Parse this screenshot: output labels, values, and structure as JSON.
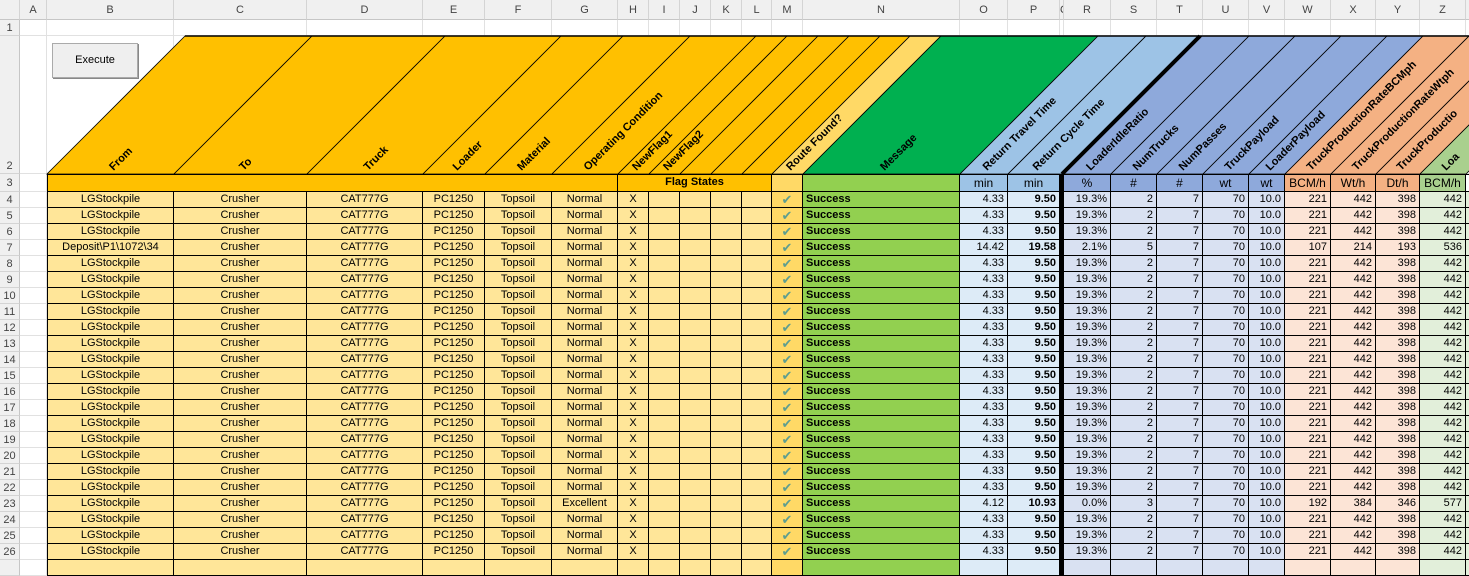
{
  "toolbar": {
    "execute_label": "Execute"
  },
  "column_letters": [
    "A",
    "B",
    "C",
    "D",
    "E",
    "F",
    "G",
    "H",
    "I",
    "J",
    "K",
    "L",
    "M",
    "N",
    "O",
    "P",
    "Q",
    "R",
    "S",
    "T",
    "U",
    "V",
    "W",
    "X",
    "Y",
    "Z",
    ""
  ],
  "row_numbers": [
    "1",
    "2",
    "3",
    "4",
    "5",
    "6",
    "7",
    "8",
    "9",
    "10",
    "11",
    "12",
    "13",
    "14",
    "15",
    "16",
    "17",
    "18",
    "19",
    "20",
    "21",
    "22",
    "23",
    "24",
    "25",
    "26"
  ],
  "headers": {
    "B": "From",
    "C": "To",
    "D": "Truck",
    "E": "Loader",
    "F": "Material",
    "G": "Operating Condition",
    "H": "NewFlag1",
    "I": "NewFlag2",
    "M": "Route Found?",
    "N": "Message",
    "O": "Return Travel Time",
    "P": "Return Cycle Time",
    "R": "LoaderIdleRatio",
    "S": "NumTrucks",
    "T": "NumPasses",
    "U": "TruckPayload",
    "V": "LoaderPayload",
    "W": "TruckProductionRateBCMph",
    "X": "TruckProductionRateWtph",
    "Y": "TruckProductio",
    "Z": "Loa"
  },
  "units": {
    "flag_states": "Flag States",
    "O": "min",
    "P": "min",
    "R": "%",
    "S": "#",
    "T": "#",
    "U": "wt",
    "V": "wt",
    "W": "BCM/h",
    "X": "Wt/h",
    "Y": "Dt/h",
    "Z": "BCM/h"
  },
  "colors": {
    "orange": "#FFC000",
    "orange_light": "#FFE699",
    "route": "#FFD966",
    "green": "#00B050",
    "message": "#92D050",
    "blue_hdr": "#9DC3E6",
    "blue_cell": "#DDEBF7",
    "purple_hdr": "#8EA9DB",
    "purple_cell": "#D9E1F2",
    "salmon_hdr": "#F4B183",
    "salmon_cell": "#FCE4D6",
    "lgreen_hdr": "#A9D08E",
    "lgreen_cell": "#E2EFDA",
    "check": "#5F9E8F"
  },
  "rows": [
    [
      "LGStockpile",
      "Crusher",
      "CAT777G",
      "PC1250",
      "Topsoil",
      "Normal",
      "X",
      "check",
      "Success",
      "4.33",
      "9.50",
      "19.3%",
      "2",
      "7",
      "70",
      "10.0",
      "221",
      "442",
      "398",
      "442"
    ],
    [
      "LGStockpile",
      "Crusher",
      "CAT777G",
      "PC1250",
      "Topsoil",
      "Normal",
      "X",
      "check",
      "Success",
      "4.33",
      "9.50",
      "19.3%",
      "2",
      "7",
      "70",
      "10.0",
      "221",
      "442",
      "398",
      "442"
    ],
    [
      "LGStockpile",
      "Crusher",
      "CAT777G",
      "PC1250",
      "Topsoil",
      "Normal",
      "X",
      "check",
      "Success",
      "4.33",
      "9.50",
      "19.3%",
      "2",
      "7",
      "70",
      "10.0",
      "221",
      "442",
      "398",
      "442"
    ],
    [
      "Deposit\\P1\\1072\\34",
      "Crusher",
      "CAT777G",
      "PC1250",
      "Topsoil",
      "Normal",
      "X",
      "check",
      "Success",
      "14.42",
      "19.58",
      "2.1%",
      "5",
      "7",
      "70",
      "10.0",
      "107",
      "214",
      "193",
      "536"
    ],
    [
      "LGStockpile",
      "Crusher",
      "CAT777G",
      "PC1250",
      "Topsoil",
      "Normal",
      "X",
      "check",
      "Success",
      "4.33",
      "9.50",
      "19.3%",
      "2",
      "7",
      "70",
      "10.0",
      "221",
      "442",
      "398",
      "442"
    ],
    [
      "LGStockpile",
      "Crusher",
      "CAT777G",
      "PC1250",
      "Topsoil",
      "Normal",
      "X",
      "check",
      "Success",
      "4.33",
      "9.50",
      "19.3%",
      "2",
      "7",
      "70",
      "10.0",
      "221",
      "442",
      "398",
      "442"
    ],
    [
      "LGStockpile",
      "Crusher",
      "CAT777G",
      "PC1250",
      "Topsoil",
      "Normal",
      "X",
      "check",
      "Success",
      "4.33",
      "9.50",
      "19.3%",
      "2",
      "7",
      "70",
      "10.0",
      "221",
      "442",
      "398",
      "442"
    ],
    [
      "LGStockpile",
      "Crusher",
      "CAT777G",
      "PC1250",
      "Topsoil",
      "Normal",
      "X",
      "check",
      "Success",
      "4.33",
      "9.50",
      "19.3%",
      "2",
      "7",
      "70",
      "10.0",
      "221",
      "442",
      "398",
      "442"
    ],
    [
      "LGStockpile",
      "Crusher",
      "CAT777G",
      "PC1250",
      "Topsoil",
      "Normal",
      "X",
      "check",
      "Success",
      "4.33",
      "9.50",
      "19.3%",
      "2",
      "7",
      "70",
      "10.0",
      "221",
      "442",
      "398",
      "442"
    ],
    [
      "LGStockpile",
      "Crusher",
      "CAT777G",
      "PC1250",
      "Topsoil",
      "Normal",
      "X",
      "check",
      "Success",
      "4.33",
      "9.50",
      "19.3%",
      "2",
      "7",
      "70",
      "10.0",
      "221",
      "442",
      "398",
      "442"
    ],
    [
      "LGStockpile",
      "Crusher",
      "CAT777G",
      "PC1250",
      "Topsoil",
      "Normal",
      "X",
      "check",
      "Success",
      "4.33",
      "9.50",
      "19.3%",
      "2",
      "7",
      "70",
      "10.0",
      "221",
      "442",
      "398",
      "442"
    ],
    [
      "LGStockpile",
      "Crusher",
      "CAT777G",
      "PC1250",
      "Topsoil",
      "Normal",
      "X",
      "check",
      "Success",
      "4.33",
      "9.50",
      "19.3%",
      "2",
      "7",
      "70",
      "10.0",
      "221",
      "442",
      "398",
      "442"
    ],
    [
      "LGStockpile",
      "Crusher",
      "CAT777G",
      "PC1250",
      "Topsoil",
      "Normal",
      "X",
      "check",
      "Success",
      "4.33",
      "9.50",
      "19.3%",
      "2",
      "7",
      "70",
      "10.0",
      "221",
      "442",
      "398",
      "442"
    ],
    [
      "LGStockpile",
      "Crusher",
      "CAT777G",
      "PC1250",
      "Topsoil",
      "Normal",
      "X",
      "check",
      "Success",
      "4.33",
      "9.50",
      "19.3%",
      "2",
      "7",
      "70",
      "10.0",
      "221",
      "442",
      "398",
      "442"
    ],
    [
      "LGStockpile",
      "Crusher",
      "CAT777G",
      "PC1250",
      "Topsoil",
      "Normal",
      "X",
      "check",
      "Success",
      "4.33",
      "9.50",
      "19.3%",
      "2",
      "7",
      "70",
      "10.0",
      "221",
      "442",
      "398",
      "442"
    ],
    [
      "LGStockpile",
      "Crusher",
      "CAT777G",
      "PC1250",
      "Topsoil",
      "Normal",
      "X",
      "check",
      "Success",
      "4.33",
      "9.50",
      "19.3%",
      "2",
      "7",
      "70",
      "10.0",
      "221",
      "442",
      "398",
      "442"
    ],
    [
      "LGStockpile",
      "Crusher",
      "CAT777G",
      "PC1250",
      "Topsoil",
      "Normal",
      "X",
      "check",
      "Success",
      "4.33",
      "9.50",
      "19.3%",
      "2",
      "7",
      "70",
      "10.0",
      "221",
      "442",
      "398",
      "442"
    ],
    [
      "LGStockpile",
      "Crusher",
      "CAT777G",
      "PC1250",
      "Topsoil",
      "Normal",
      "X",
      "check",
      "Success",
      "4.33",
      "9.50",
      "19.3%",
      "2",
      "7",
      "70",
      "10.0",
      "221",
      "442",
      "398",
      "442"
    ],
    [
      "LGStockpile",
      "Crusher",
      "CAT777G",
      "PC1250",
      "Topsoil",
      "Normal",
      "X",
      "check",
      "Success",
      "4.33",
      "9.50",
      "19.3%",
      "2",
      "7",
      "70",
      "10.0",
      "221",
      "442",
      "398",
      "442"
    ],
    [
      "LGStockpile",
      "Crusher",
      "CAT777G",
      "PC1250",
      "Topsoil",
      "Excellent",
      "X",
      "check",
      "Success",
      "4.12",
      "10.93",
      "0.0%",
      "3",
      "7",
      "70",
      "10.0",
      "192",
      "384",
      "346",
      "577"
    ],
    [
      "LGStockpile",
      "Crusher",
      "CAT777G",
      "PC1250",
      "Topsoil",
      "Normal",
      "X",
      "check",
      "Success",
      "4.33",
      "9.50",
      "19.3%",
      "2",
      "7",
      "70",
      "10.0",
      "221",
      "442",
      "398",
      "442"
    ],
    [
      "LGStockpile",
      "Crusher",
      "CAT777G",
      "PC1250",
      "Topsoil",
      "Normal",
      "X",
      "check",
      "Success",
      "4.33",
      "9.50",
      "19.3%",
      "2",
      "7",
      "70",
      "10.0",
      "221",
      "442",
      "398",
      "442"
    ],
    [
      "LGStockpile",
      "Crusher",
      "CAT777G",
      "PC1250",
      "Topsoil",
      "Normal",
      "X",
      "check",
      "Success",
      "4.33",
      "9.50",
      "19.3%",
      "2",
      "7",
      "70",
      "10.0",
      "221",
      "442",
      "398",
      "442"
    ]
  ]
}
